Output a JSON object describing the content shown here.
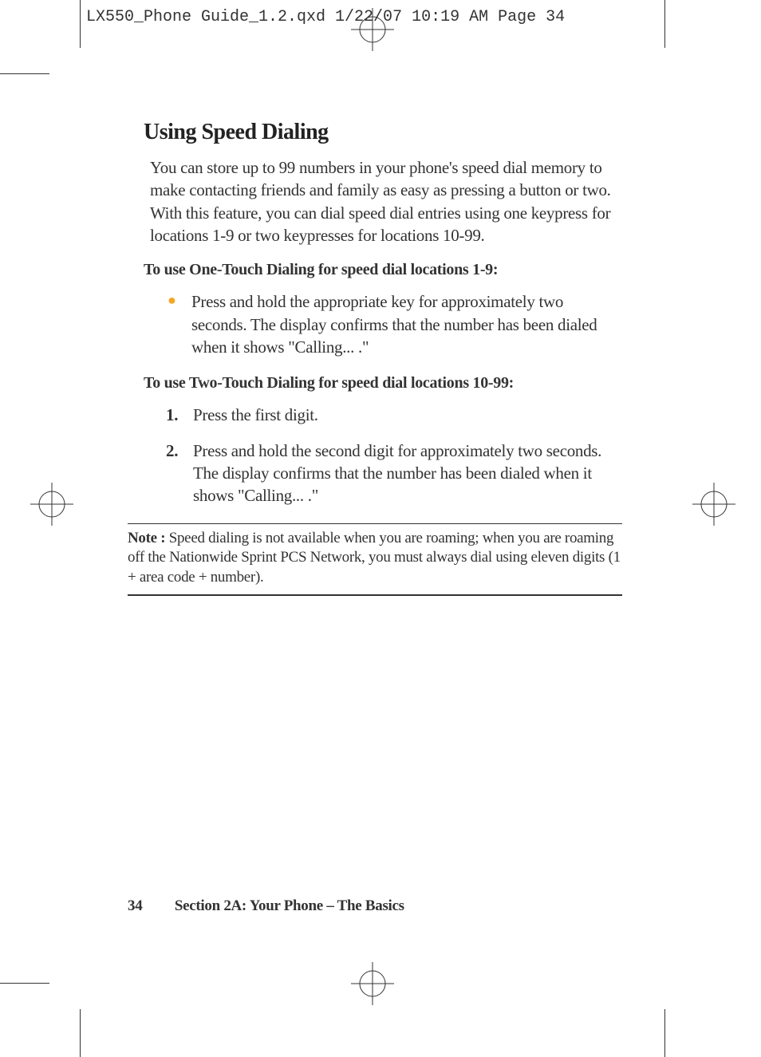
{
  "header": {
    "slug": "LX550_Phone Guide_1.2.qxd  1/22/07  10:19 AM  Page 34"
  },
  "section": {
    "title": "Using Speed Dialing",
    "intro": "You can store up to 99 numbers in your phone's speed dial memory to make contacting friends and family as easy as pressing a button or two. With this feature, you can dial speed dial entries using one keypress for locations 1-9 or two keypresses for locations 10-99.",
    "subhead1": "To use One-Touch Dialing for speed dial locations 1-9:",
    "bullet1": "Press and hold the appropriate key for approximately two seconds. The display confirms that the number has been dialed when it shows \"Calling... .\"",
    "subhead2": "To use Two-Touch Dialing for speed dial locations 10-99:",
    "steps": [
      {
        "num": "1.",
        "text": "Press the first digit."
      },
      {
        "num": "2.",
        "text": "Press and hold the second digit for approximately two seconds. The display confirms that the number has been dialed when it shows \"Calling... .\""
      }
    ],
    "note_label": "Note : ",
    "note_text": "Speed dialing is not available when you are roaming; when you are roaming off the Nationwide Sprint PCS Network, you must always dial using eleven digits (1 + area code + number)."
  },
  "footer": {
    "page_number": "34",
    "section_label": "Section 2A: Your Phone – The Basics"
  }
}
